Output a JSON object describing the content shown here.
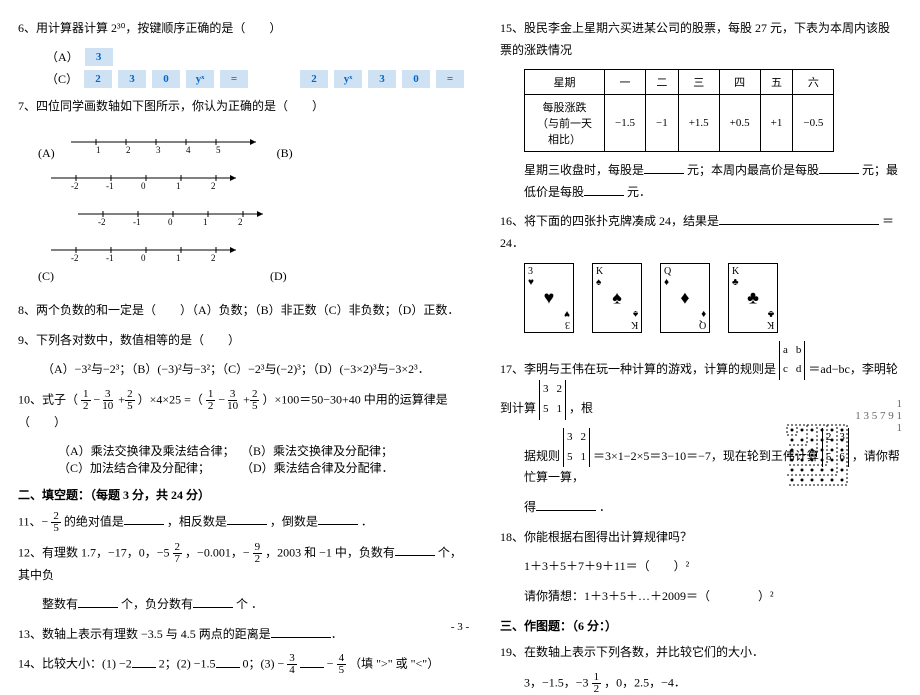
{
  "left": {
    "q6": "6、用计算器计算 2³⁰，按键顺序正确的是（　　）",
    "q6A": "（A）",
    "q6C": "（C）",
    "btns_A": [
      "3"
    ],
    "btns_C": [
      "2",
      "3",
      "0",
      "yˣ",
      "="
    ],
    "btns_Cr": [
      "2",
      "yˣ",
      "3",
      "0",
      "="
    ],
    "q7": "7、四位同学画数轴如下图所示，你认为正确的是（　　）",
    "q7_labels": {
      "A": "(A)",
      "B": "(B)",
      "C": "(C)",
      "D": "(D)"
    },
    "q8": "8、两个负数的和一定是（　　）（A）负数；（B）非正数（C）非负数；（D）正数．",
    "q9": "9、下列各对数中，数值相等的是（　　）",
    "q9sub": "（A）−3²与−2³；（B）(−3)²与−3²；（C）−2³与(−2)³；（D）(−3×2)³与−3×2³．",
    "q10": "10、式子（",
    "q10mid": "）×4×25 =（",
    "q10end": "）×100＝50−30+40 中用的运算律是（　　）",
    "q10opts": {
      "A": "（A）乘法交换律及乘法结合律；",
      "B": "（B）乘法交换律及分配律；",
      "C": "（C）加法结合律及分配律；",
      "D": "（D）乘法结合律及分配律．"
    },
    "sec2": "二、填空题：（每题 3 分，共 24 分）",
    "q11a": "11、−",
    "q11b": " 的绝对值是",
    "q11c": "，相反数是",
    "q11d": "，倒数是",
    "q11e": "．",
    "q12a": "12、有理数 1.7，−17，0，−5",
    "q12b": "，−0.001，−",
    "q12c": "，2003 和 −1 中，负数有",
    "q12d": "个，其中负",
    "q12e": "整数有",
    "q12f": "个，负分数有",
    "q12g": "个 ．",
    "q13": "13、数轴上表示有理数 −3.5 与 4.5 两点的距离是",
    "q14a": "14、比较大小：(1) −2",
    "q14b": "2；(2) −1.5",
    "q14c": "0；(3) −",
    "q14d": "−",
    "q14e": "（填 \">\" 或 \"<\"）",
    "fr": {
      "2_5n": "2",
      "2_5d": "5",
      "5_2_7n": "2",
      "5_2_7d": "7",
      "9_2n": "9",
      "9_2d": "2",
      "3_4n": "3",
      "3_4d": "4",
      "4_5n": "4",
      "4_5d": "5",
      "1_2n": "1",
      "1_2d": "2",
      "3_10n": "3",
      "3_10d": "10"
    }
  },
  "right": {
    "q15": "15、股民李金上星期六买进某公司的股票，每股 27 元，下表为本周内该股票的涨跌情况",
    "table": {
      "h": [
        "星期",
        "一",
        "二",
        "三",
        "四",
        "五",
        "六"
      ],
      "r1label": "每股涨跌（与前一天相比）",
      "r1": [
        "−1.5",
        "−1",
        "+1.5",
        "+0.5",
        "+1",
        "−0.5"
      ]
    },
    "q15b_a": "星期三收盘时，每股是",
    "q15b_b": "元；本周内最高价是每股",
    "q15b_c": "元；最低价是每股",
    "q15b_d": "元．",
    "q16a": "16、将下面的四张扑克牌凑成 24，结果是",
    "q16b": "＝24．",
    "cards": [
      {
        "rank": "3",
        "suit": "♥",
        "mid": "♥"
      },
      {
        "rank": "K",
        "suit": "♠",
        "mid": "♠"
      },
      {
        "rank": "Q",
        "suit": "♦",
        "mid": "♦"
      },
      {
        "rank": "K",
        "suit": "♣",
        "mid": "♣"
      }
    ],
    "q17a": "17、李明与王伟在玩一种计算的游戏，计算的规则是",
    "q17b": "＝ad−bc，李明轮到计算",
    "q17c": "，根",
    "q17d": "据规则",
    "q17e": "＝3×1−2×5＝3−10＝−7，现在轮到王伟计算",
    "q17f": "，请你帮忙算一算，",
    "q17g": "得",
    "q17h": "．",
    "det1": {
      "a": "a",
      "b": "b",
      "c": "c",
      "d": "d"
    },
    "det2": {
      "a": "3",
      "b": "2",
      "c": "5",
      "d": "1"
    },
    "det3": {
      "a": "3",
      "b": "2",
      "c": "5",
      "d": "1"
    },
    "det4": {
      "a": "2",
      "b": "3",
      "c": "5",
      "d": "6"
    },
    "q18": "18、你能根据右图得出计算规律吗？",
    "q18a": "1＋3＋5＋7＋9＋11＝（　　）²",
    "q18b": "请你猜想：1＋3＋5＋…＋2009＝（　　　　）²",
    "topnums": "1  3  5  7  9  1",
    "one": "1",
    "sec3": "三、作图题：（6 分：）",
    "q19": "19、在数轴上表示下列各数，并比较它们的大小．",
    "q19b": "3，−1.5，−3",
    "q19c": "，0，2.5，−4．",
    "fr": {
      "1_2n": "1",
      "1_2d": "2"
    }
  },
  "footer": "- 3 -"
}
